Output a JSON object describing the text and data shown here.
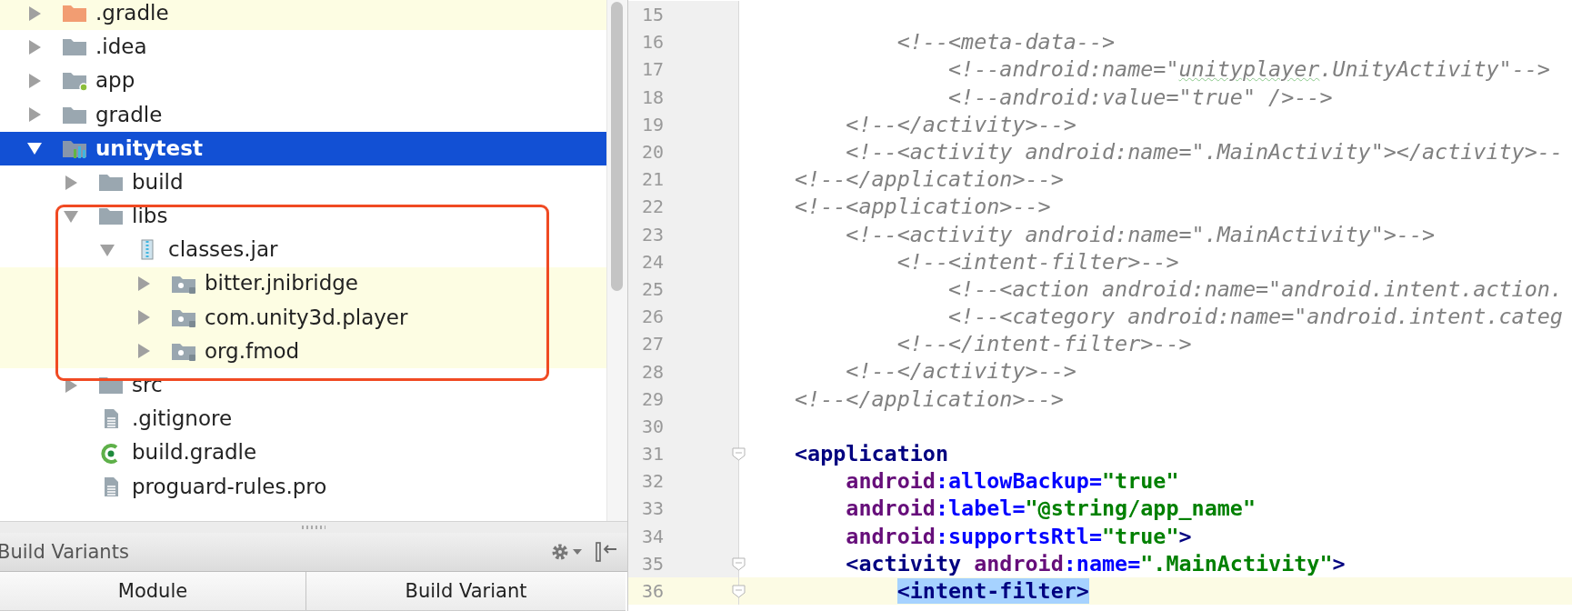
{
  "project_tree": {
    "items": [
      {
        "label": ".gradle",
        "kind": "folder-orange",
        "expanded": false,
        "selected": false,
        "library": true,
        "outlined": false
      },
      {
        "label": ".idea",
        "kind": "folder",
        "expanded": false,
        "selected": false,
        "library": false,
        "outlined": false
      },
      {
        "label": "app",
        "kind": "module-app",
        "expanded": false,
        "selected": false,
        "library": false,
        "outlined": false
      },
      {
        "label": "gradle",
        "kind": "folder",
        "expanded": false,
        "selected": false,
        "library": false,
        "outlined": false
      },
      {
        "label": "unitytest",
        "kind": "module",
        "expanded": true,
        "selected": true,
        "library": false,
        "outlined": false,
        "children": [
          {
            "label": "build",
            "kind": "folder",
            "expanded": false,
            "selected": false,
            "library": false,
            "outlined": false
          },
          {
            "label": "libs",
            "kind": "folder",
            "expanded": true,
            "selected": false,
            "library": false,
            "outlined": true,
            "children": [
              {
                "label": "classes.jar",
                "kind": "jar",
                "expanded": true,
                "selected": false,
                "library": false,
                "outlined": false,
                "children": [
                  {
                    "label": "bitter.jnibridge",
                    "kind": "package",
                    "expanded": false,
                    "selected": false,
                    "library": true,
                    "outlined": false
                  },
                  {
                    "label": "com.unity3d.player",
                    "kind": "package",
                    "expanded": false,
                    "selected": false,
                    "library": true,
                    "outlined": false
                  },
                  {
                    "label": "org.fmod",
                    "kind": "package",
                    "expanded": false,
                    "selected": false,
                    "library": true,
                    "outlined": false
                  }
                ]
              }
            ]
          },
          {
            "label": "src",
            "kind": "folder",
            "expanded": false,
            "selected": false,
            "library": false,
            "outlined": false
          },
          {
            "label": ".gitignore",
            "kind": "file",
            "selected": false,
            "library": false,
            "outlined": false
          },
          {
            "label": "build.gradle",
            "kind": "gradle",
            "selected": false,
            "library": false,
            "outlined": false
          },
          {
            "label": "proguard-rules.pro",
            "kind": "file",
            "selected": false,
            "library": false,
            "outlined": false
          }
        ]
      }
    ]
  },
  "build_variants": {
    "title": "Build Variants",
    "columns": [
      "Module",
      "Build Variant"
    ]
  },
  "editor": {
    "lines": [
      {
        "number": "15",
        "current": false,
        "fold": false
      },
      {
        "number": "16",
        "current": false,
        "fold": false,
        "tokens": [
          {
            "kind": "comment",
            "text": "        <!--<meta-data-->"
          }
        ]
      },
      {
        "number": "17",
        "current": false,
        "fold": false,
        "tokens": [
          {
            "kind": "comment",
            "text": "            <!--android:name=\""
          },
          {
            "kind": "typo",
            "text": "unityplayer"
          },
          {
            "kind": "comment",
            "text": ".UnityActivity\"-->"
          }
        ]
      },
      {
        "number": "18",
        "current": false,
        "fold": false,
        "tokens": [
          {
            "kind": "comment",
            "text": "            <!--android:value=\"true\" />-->"
          }
        ]
      },
      {
        "number": "19",
        "current": false,
        "fold": false,
        "tokens": [
          {
            "kind": "comment",
            "text": "    <!--</activity>-->"
          }
        ]
      },
      {
        "number": "20",
        "current": false,
        "fold": false,
        "tokens": [
          {
            "kind": "comment",
            "text": "    <!--<activity android:name=\".MainActivity\"></activity>--"
          }
        ]
      },
      {
        "number": "21",
        "current": false,
        "fold": false,
        "tokens": [
          {
            "kind": "comment",
            "text": "<!--</application>-->"
          }
        ]
      },
      {
        "number": "22",
        "current": false,
        "fold": false,
        "tokens": [
          {
            "kind": "comment",
            "text": "<!--<application>-->"
          }
        ]
      },
      {
        "number": "23",
        "current": false,
        "fold": false,
        "tokens": [
          {
            "kind": "comment",
            "text": "    <!--<activity android:name=\".MainActivity\">-->"
          }
        ]
      },
      {
        "number": "24",
        "current": false,
        "fold": false,
        "tokens": [
          {
            "kind": "comment",
            "text": "        <!--<intent-filter>-->"
          }
        ]
      },
      {
        "number": "25",
        "current": false,
        "fold": false,
        "tokens": [
          {
            "kind": "comment",
            "text": "            <!--<action android:name=\"android.intent.action."
          }
        ]
      },
      {
        "number": "26",
        "current": false,
        "fold": false,
        "tokens": [
          {
            "kind": "comment",
            "text": "            <!--<category android:name=\"android.intent.categ"
          }
        ]
      },
      {
        "number": "27",
        "current": false,
        "fold": false,
        "tokens": [
          {
            "kind": "comment",
            "text": "        <!--</intent-filter>-->"
          }
        ]
      },
      {
        "number": "28",
        "current": false,
        "fold": false,
        "tokens": [
          {
            "kind": "comment",
            "text": "    <!--</activity>-->"
          }
        ]
      },
      {
        "number": "29",
        "current": false,
        "fold": false,
        "tokens": [
          {
            "kind": "comment",
            "text": "<!--</application>-->"
          }
        ]
      },
      {
        "number": "30",
        "current": false,
        "fold": false
      },
      {
        "number": "31",
        "current": false,
        "fold": true,
        "tokens": [
          {
            "kind": "tag",
            "text": "<application"
          }
        ]
      },
      {
        "number": "32",
        "current": false,
        "fold": false,
        "tokens": [
          {
            "kind": "ns",
            "text": "    android"
          },
          {
            "kind": "attr",
            "text": ":allowBackup="
          },
          {
            "kind": "value",
            "text": "\"true\""
          }
        ]
      },
      {
        "number": "33",
        "current": false,
        "fold": false,
        "tokens": [
          {
            "kind": "ns",
            "text": "    android"
          },
          {
            "kind": "attr",
            "text": ":label="
          },
          {
            "kind": "value",
            "text": "\"@string/app_name\""
          }
        ]
      },
      {
        "number": "34",
        "current": false,
        "fold": false,
        "tokens": [
          {
            "kind": "ns",
            "text": "    android"
          },
          {
            "kind": "attr",
            "text": ":supportsRtl="
          },
          {
            "kind": "value",
            "text": "\"true\""
          },
          {
            "kind": "tag",
            "text": ">"
          }
        ]
      },
      {
        "number": "35",
        "current": false,
        "fold": true,
        "tokens": [
          {
            "kind": "tag",
            "text": "    <activity "
          },
          {
            "kind": "ns",
            "text": "android"
          },
          {
            "kind": "attr",
            "text": ":name="
          },
          {
            "kind": "value",
            "text": "\".MainActivity\""
          },
          {
            "kind": "tag",
            "text": ">"
          }
        ]
      },
      {
        "number": "36",
        "current": true,
        "fold": true,
        "tokens": [
          {
            "kind": "tag-selected",
            "text": "        <intent-filter>"
          }
        ]
      }
    ]
  }
}
